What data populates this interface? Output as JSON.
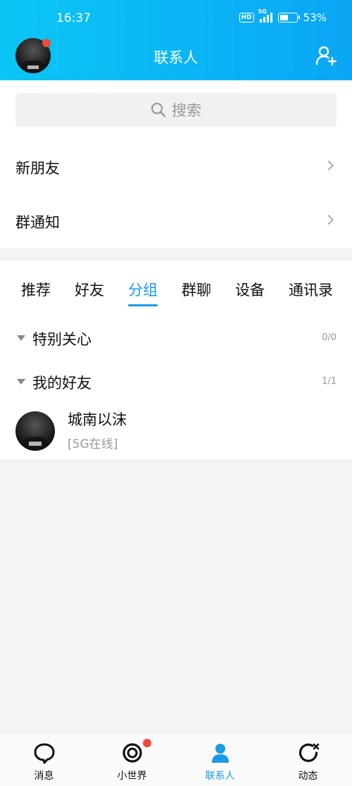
{
  "status_bar": {
    "time": "16:37",
    "network": "5G",
    "hd": "HD",
    "battery_percent_text": "53%",
    "battery_level": 0.53
  },
  "header": {
    "title": "联系人",
    "avatar_has_notification": true
  },
  "search": {
    "placeholder": "搜索"
  },
  "menu": [
    {
      "label": "新朋友"
    },
    {
      "label": "群通知"
    }
  ],
  "tabs": [
    {
      "label": "推荐"
    },
    {
      "label": "好友"
    },
    {
      "label": "分组",
      "active": true
    },
    {
      "label": "群聊"
    },
    {
      "label": "设备"
    },
    {
      "label": "通讯录"
    }
  ],
  "groups": [
    {
      "name": "特别关心",
      "count": "0/0"
    },
    {
      "name": "我的好友",
      "count": "1/1"
    }
  ],
  "contacts": [
    {
      "name": "城南以沫",
      "status": "[5G在线]"
    }
  ],
  "bottom_nav": [
    {
      "label": "消息",
      "icon": "chat-bubble-icon"
    },
    {
      "label": "小世界",
      "icon": "world-ring-icon",
      "badge": true
    },
    {
      "label": "联系人",
      "icon": "contact-person-icon",
      "active": true
    },
    {
      "label": "动态",
      "icon": "refresh-star-icon"
    }
  ],
  "colors": {
    "header_start": "#0bc6f5",
    "header_end": "#0aa6f5",
    "accent": "#1a9ae8",
    "badge": "#f04a3a"
  }
}
